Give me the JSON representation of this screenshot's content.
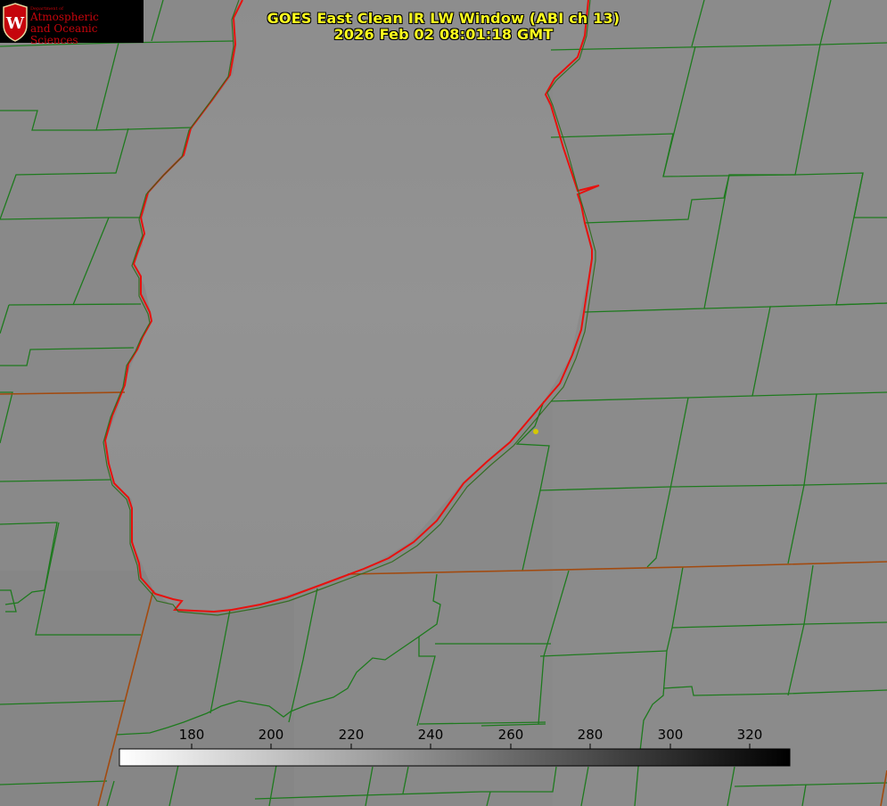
{
  "header": {
    "title_line1": "GOES East Clean IR LW Window (ABI ch 13)",
    "title_line2": "2026 Feb 02 08:01:18 GMT"
  },
  "logo": {
    "department": "Department of",
    "line1": "Atmospheric",
    "line2": "and Oceanic Sciences",
    "emblem_letter": "W"
  },
  "colorbar": {
    "ticks": [
      "180",
      "200",
      "220",
      "240",
      "260",
      "280",
      "300",
      "320"
    ],
    "range": [
      162,
      330
    ],
    "gradient": "white-to-black"
  },
  "colors": {
    "background_gray": "#878787",
    "lake_gray": "#8f8f8f",
    "county_lines": "#1e7a1e",
    "state_lines": "#a24a0f",
    "coastline": "#e8110e",
    "title_text": "#ffff1e",
    "logo_red": "#c5050c"
  },
  "map": {
    "marker": "city-dot"
  }
}
